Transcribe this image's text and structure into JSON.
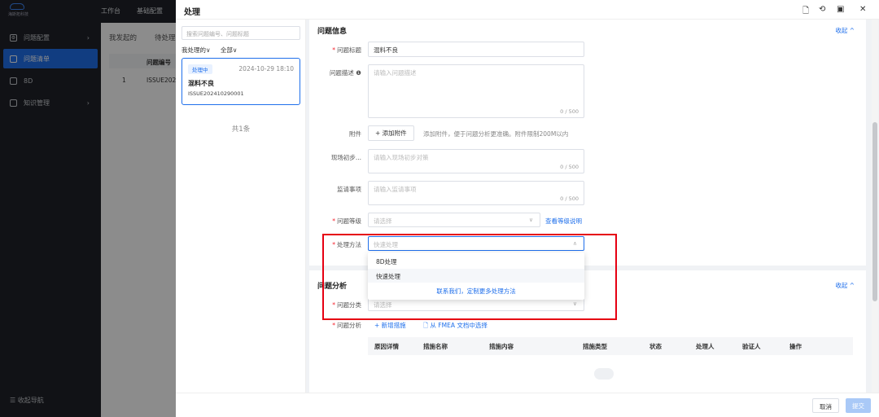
{
  "sidebar": {
    "logo_text": "海斯拓科技",
    "items": [
      {
        "label": "问题配置",
        "icon": "gear-icon"
      },
      {
        "label": "问题清单",
        "icon": "list-icon"
      },
      {
        "label": "8D",
        "icon": "chart-icon"
      },
      {
        "label": "知识管理",
        "icon": "book-icon"
      }
    ],
    "collapse_label": "收起导航"
  },
  "topbar": {
    "items": [
      "工作台",
      "基础配置"
    ]
  },
  "background_page": {
    "tabs": [
      "我发起的",
      "待处理"
    ],
    "table_header": "问题编号",
    "row_index": "1",
    "row_code": "ISSUE2024"
  },
  "drawer": {
    "title": "处理",
    "search_placeholder": "搜索问题编号、问题标题",
    "filter_mine": "我处理的∨",
    "filter_all": "全部∨",
    "card": {
      "status": "处理中",
      "date": "2024-10-29 18:10",
      "title": "混料不良",
      "code": "ISSUE202410290001"
    },
    "total": "共1条",
    "info_section": {
      "title": "问题信息",
      "collapse": "收起 ^",
      "title_label": "问题标题",
      "title_value": "混料不良",
      "desc_label": "问题描述 ❶",
      "desc_placeholder": "请输入问题描述",
      "desc_count": "0 / 500",
      "attach_label": "附件",
      "attach_button": "+ 添加附件",
      "attach_hint": "添加附件，便于问题分析更准确。附件限制200M以内",
      "onsite_label": "现场初步...",
      "onsite_placeholder": "请输入现场初步对策",
      "onsite_count": "0 / 500",
      "audit_label": "监请事项",
      "audit_placeholder": "请输入监请事项",
      "audit_count": "0 / 500",
      "level_label": "问题等级",
      "level_placeholder": "请选择",
      "level_link": "查看等级说明",
      "method_label": "处理方法",
      "method_value": "快速处理",
      "dropdown_options": [
        "8D处理",
        "快速处理"
      ],
      "dropdown_link": "联系我们，定制更多处理方法"
    },
    "analysis_section": {
      "title": "问题分析",
      "collapse": "收起 ^",
      "category_label": "问题分类",
      "category_placeholder": "请选择",
      "analysis_label": "问题分析",
      "add_measure": "+ 新增措施",
      "from_fmea": "🗋 从 FMEA 文档中选择",
      "columns": [
        "原因详情",
        "措施名称",
        "措施内容",
        "措施类型",
        "状态",
        "处理人",
        "验证人",
        "操作"
      ]
    },
    "footer": {
      "cancel": "取消",
      "submit": "提交"
    }
  },
  "colors": {
    "accent": "#1f6feb",
    "highlight_box": "#e60012",
    "sidebar_bg": "#1f2228"
  }
}
